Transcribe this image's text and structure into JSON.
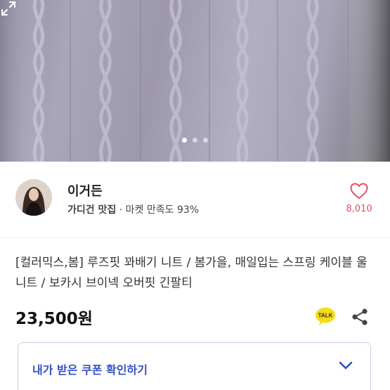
{
  "gallery": {
    "dot_count": 3,
    "active_index": 0
  },
  "seller": {
    "name": "이거든",
    "shop_label": "가디건 맛집",
    "separator": "·",
    "rating_label": "마켓 만족도",
    "rating_value": "93%",
    "like_count": "8,010"
  },
  "product": {
    "title": "[컬러믹스,봄] 루즈핏 꽈배기 니트 / 봄가을, 매일입는 스프링 케이블 울니트 / 보카시 브이넥 오버핏 긴팔티",
    "price": "23,500원",
    "talk_badge": "TALK"
  },
  "coupon": {
    "label": "내가 받은 쿠폰 확인하기"
  },
  "colors": {
    "accent_blue": "#3151c4",
    "heart_red": "#e05263",
    "talk_yellow": "#f5dc1a"
  },
  "icons": [
    "expand-icon",
    "heart-icon",
    "kakao-talk-icon",
    "share-icon",
    "chevron-down-icon"
  ]
}
